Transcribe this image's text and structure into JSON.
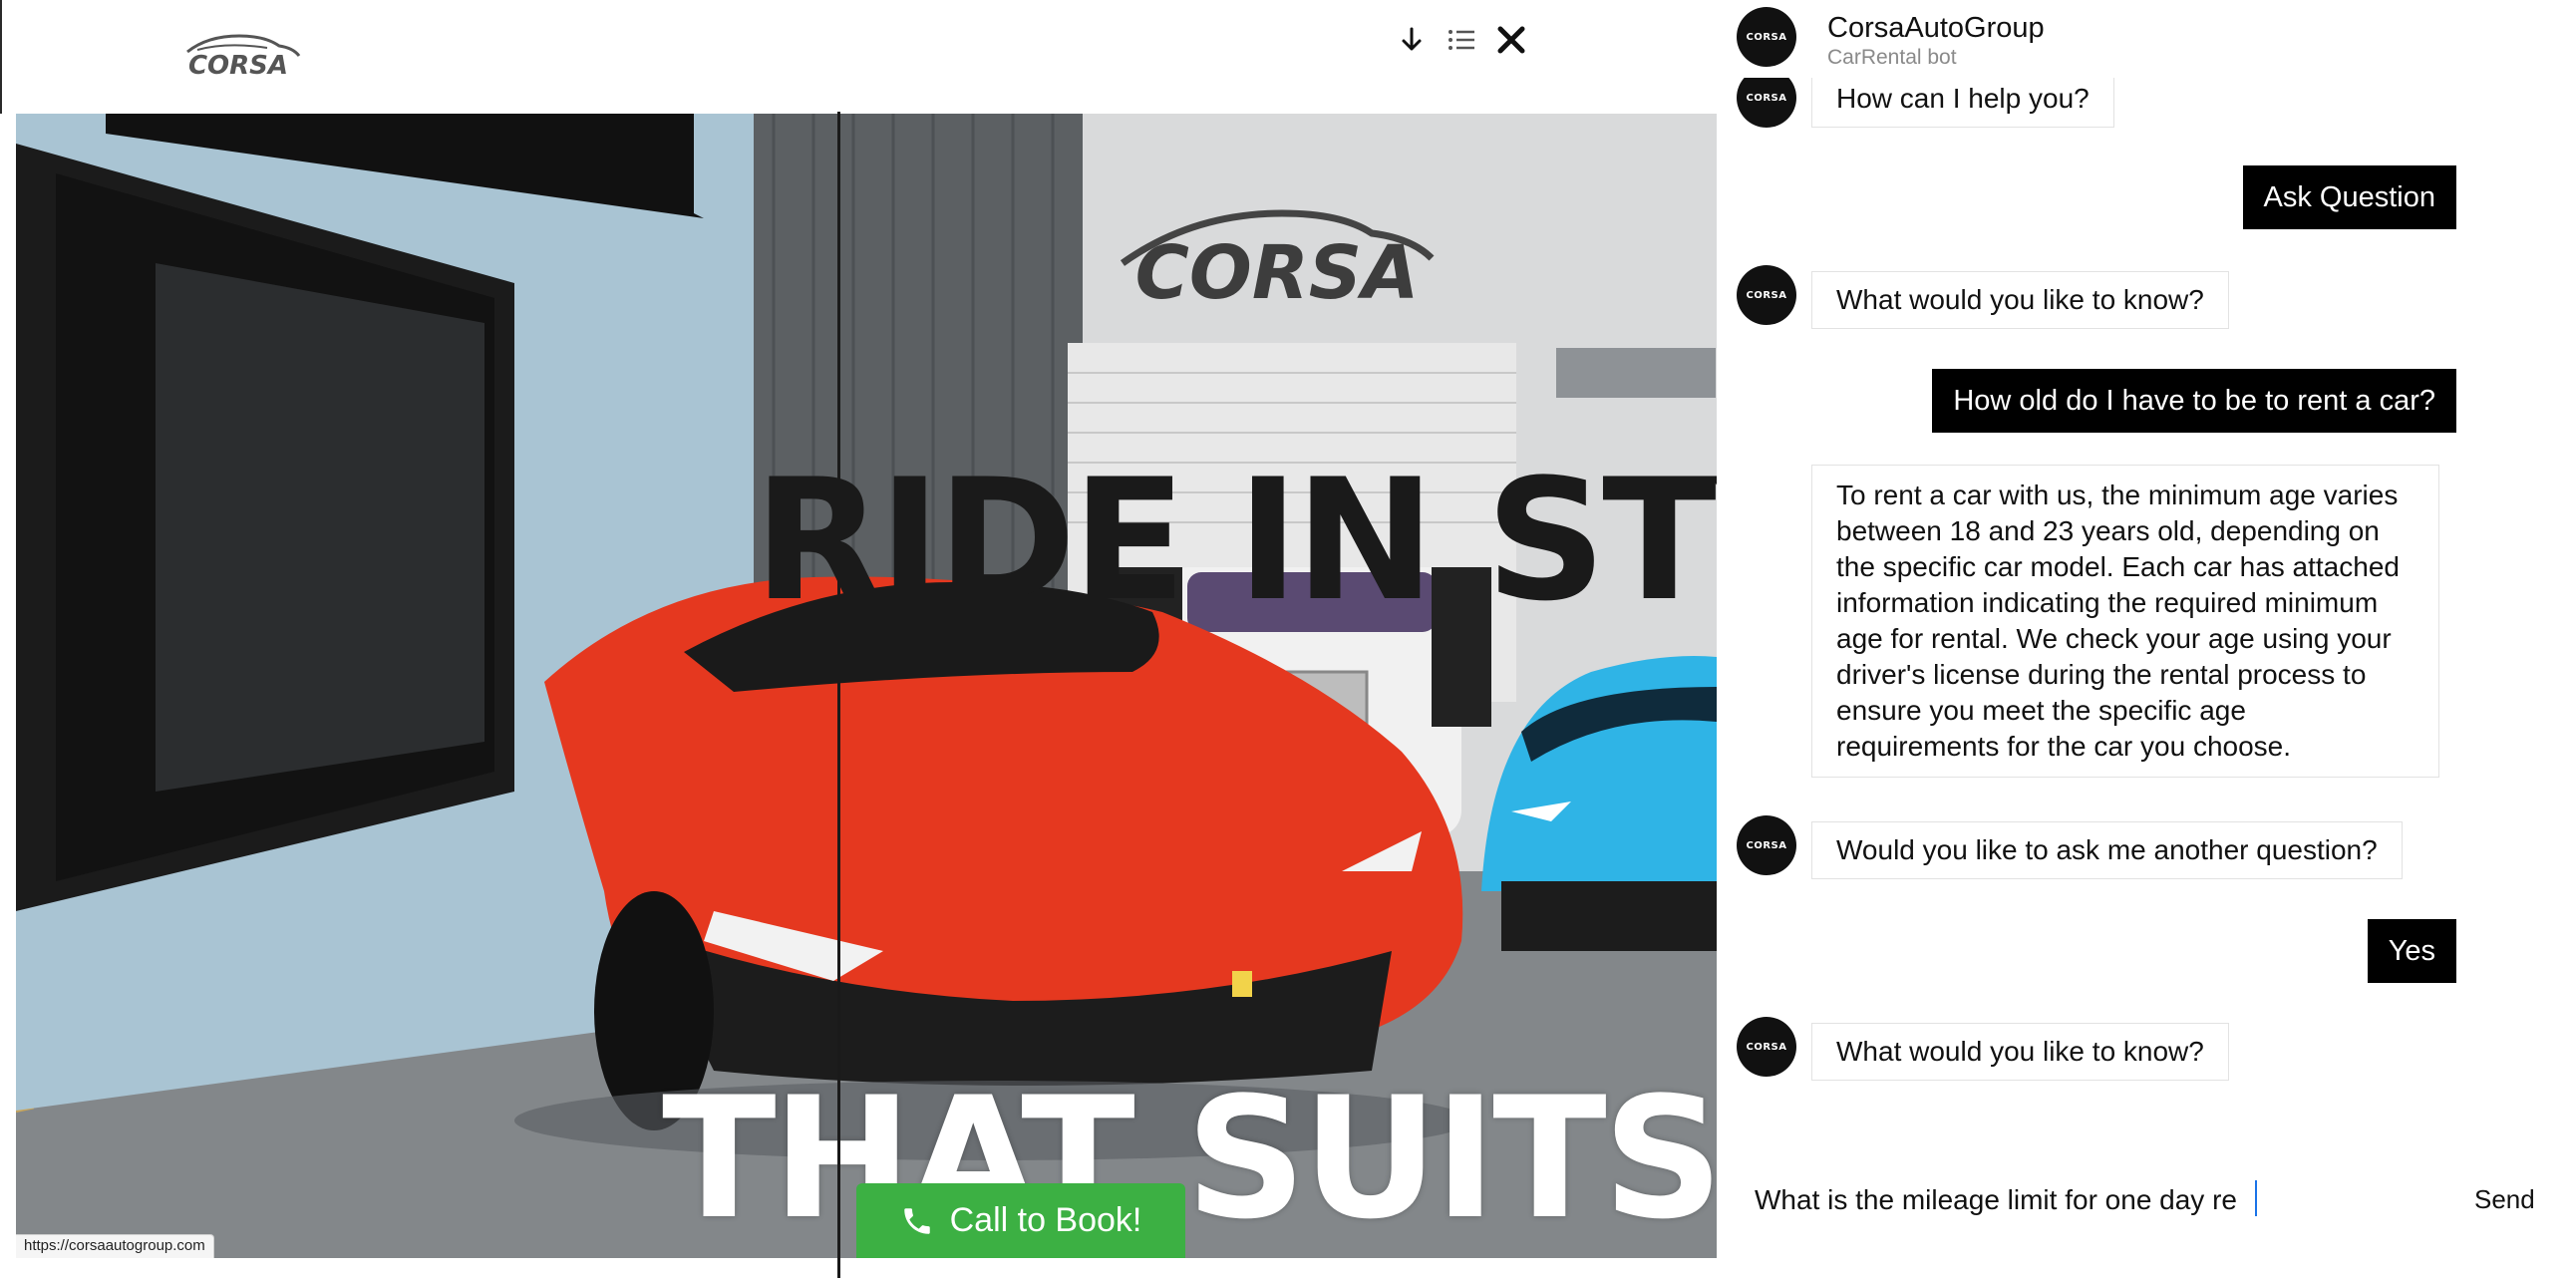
{
  "site": {
    "logo_text": "CORSA",
    "hero_line_1": "RIDE IN STYL",
    "hero_line_2": "THAT SUITS YO",
    "call_button_label": "Call to Book!",
    "status_url": "https://corsaautogroup.com"
  },
  "chat": {
    "title": "CorsaAutoGroup",
    "subtitle": "CarRental bot",
    "avatar_text": "CORSA",
    "icons": [
      "arrow-down-icon",
      "list-icon",
      "close-icon"
    ],
    "messages": [
      {
        "from": "bot",
        "text": "How can I help you?"
      },
      {
        "from": "user",
        "text": "Ask Question"
      },
      {
        "from": "bot",
        "text": "What would you like to know?"
      },
      {
        "from": "user",
        "text": "How old do I have to be to rent a car?"
      },
      {
        "from": "bot",
        "text": "To rent a car with us, the minimum age varies between 18 and 23 years old, depending on the specific car model. Each car has attached information indicating the required minimum age for rental. We check your age using your driver's license during the rental process to ensure you meet the specific age requirements for the car you choose."
      },
      {
        "from": "bot",
        "text": "Would you like to ask me another question?"
      },
      {
        "from": "user",
        "text": "Yes"
      },
      {
        "from": "bot",
        "text": "What would you like to know?"
      }
    ],
    "composer": {
      "value": "What is the mileage limit for one day re",
      "send_label": "Send"
    }
  },
  "colors": {
    "call_button": "#3cb043",
    "user_bubble": "#000000",
    "car_red": "#e5381f",
    "car_blue": "#2fb4e6"
  }
}
